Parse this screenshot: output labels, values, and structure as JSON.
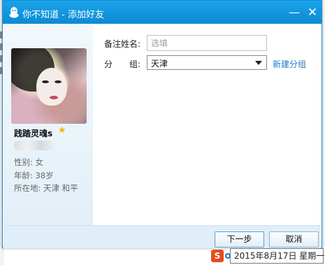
{
  "window": {
    "title": "你不知道 - 添加好友",
    "minimize_label": "—",
    "close_label": "✕",
    "accent": "#0d8ad6"
  },
  "profile": {
    "nickname": "践踏灵魂s",
    "star_icon": "★",
    "gender": "性别: 女",
    "age": "年龄: 38岁",
    "location": "所在地: 天津  和平"
  },
  "form": {
    "remark_label": "备注姓名:",
    "remark_placeholder": "选填",
    "remark_value": "",
    "group_label_a": "分",
    "group_label_b": "组:",
    "group_selected": "天津",
    "new_group_link": "新建分组"
  },
  "buttons": {
    "next": "下一步",
    "cancel": "取消"
  },
  "taskbar": {
    "ime_label": "S",
    "datetime_tooltip": "2015年8月17日 星期一"
  }
}
